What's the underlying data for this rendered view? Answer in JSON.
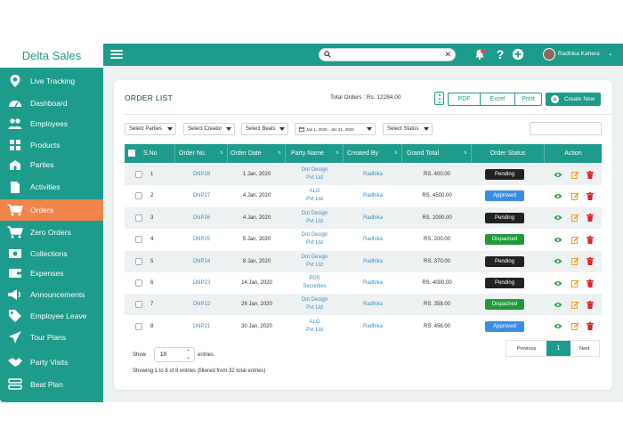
{
  "app": {
    "brand": "Delta Sales"
  },
  "sidebar": {
    "items": [
      {
        "label": "Live Tracking",
        "icon": "map-pin-icon"
      },
      {
        "label": "Dashboard",
        "icon": "speedometer-icon"
      },
      {
        "label": "Employees",
        "icon": "users-icon"
      },
      {
        "label": "Products",
        "icon": "grid-icon"
      },
      {
        "label": "Parties",
        "icon": "building-icon"
      },
      {
        "label": "Activities",
        "icon": "document-icon"
      },
      {
        "label": "Orders",
        "icon": "cart-icon",
        "active": true
      },
      {
        "label": "Zero Orders",
        "icon": "cart-icon"
      },
      {
        "label": "Collections",
        "icon": "cash-icon"
      },
      {
        "label": "Expenses",
        "icon": "wallet-icon"
      },
      {
        "label": "Announcements",
        "icon": "megaphone-icon"
      },
      {
        "label": "Employee Leave",
        "icon": "tag-icon"
      },
      {
        "label": "Tour Plans",
        "icon": "plane-icon"
      },
      {
        "label": "Party Visits",
        "icon": "handshake-icon"
      },
      {
        "label": "Beat Plan",
        "icon": "list-icon"
      }
    ]
  },
  "topbar": {
    "search_value": "",
    "user_name": "Radhika Kahera",
    "icons": [
      "notification-icon",
      "help-icon",
      "add-icon"
    ]
  },
  "page": {
    "title": "ORDER LIST",
    "total_orders": "Total Orders : Rs. 12284.00",
    "export_buttons": [
      "PDF",
      "Excel",
      "Print"
    ],
    "create_label": "Create New",
    "filters": [
      "Select Parties",
      "Select Creator",
      "Select Beats",
      "Jan 1, 2020 - Jan 31, 2020",
      "Select Status"
    ]
  },
  "table": {
    "headers": [
      "S.No",
      "Order No.",
      "Order Date",
      "Party Name",
      "Created By",
      "Grand Total",
      "Order Status",
      "Action"
    ],
    "rows": [
      {
        "sno": "1",
        "order_no": "DNP28",
        "date": "1 Jan, 2020",
        "party": [
          "Dot Design",
          "Pvt Ltd"
        ],
        "created_by": "Radhika",
        "total": "RS. 400.00",
        "status": "Pending"
      },
      {
        "sno": "2",
        "order_no": "DNP27",
        "date": "4 Jan, 2020",
        "party": [
          "ALG",
          "Pvt Ltd"
        ],
        "created_by": "Radhika",
        "total": "RS. 4500.00",
        "status": "Approved"
      },
      {
        "sno": "3",
        "order_no": "DNP26",
        "date": "4 Jan, 2020",
        "party": [
          "Dot Design",
          "Pvt Ltd"
        ],
        "created_by": "Radhika",
        "total": "RS. 2000.00",
        "status": "Pending"
      },
      {
        "sno": "4",
        "order_no": "DNP25",
        "date": "5 Jan, 2020",
        "party": [
          "Dot Design",
          "Pvt Ltd"
        ],
        "created_by": "Radhika",
        "total": "RS. 200.00",
        "status": "Dispached"
      },
      {
        "sno": "5",
        "order_no": "DNP24",
        "date": "8 Jan, 2020",
        "party": [
          "Dot Design",
          "Pvt Ltd"
        ],
        "created_by": "Radhika",
        "total": "RS. 370.00",
        "status": "Pending"
      },
      {
        "sno": "6",
        "order_no": "DNP23",
        "date": "14 Jan, 2020",
        "party": [
          "PDS",
          "Securities"
        ],
        "created_by": "Radhika",
        "total": "RS. 4000.00",
        "status": "Pending"
      },
      {
        "sno": "7",
        "order_no": "DNP22",
        "date": "26 Jan, 2020",
        "party": [
          "Dot Design",
          "Pvt Ltd"
        ],
        "created_by": "Radhika",
        "total": "RS. 358.00",
        "status": "Dispached"
      },
      {
        "sno": "8",
        "order_no": "DNP21",
        "date": "30 Jan, 2020",
        "party": [
          "ALG",
          "Pvt Ltd"
        ],
        "created_by": "Radhika",
        "total": "RS. 456.00",
        "status": "Approved"
      }
    ]
  },
  "footer": {
    "show_label": "Show",
    "entries_value": "10",
    "entries_label": "entries",
    "showing_text": "Showing 1 to 8 of 8 entries (filtered from 32 total entries)",
    "pager": {
      "previous": "Previous",
      "current": "1",
      "next": "Next"
    }
  },
  "colors": {
    "primary": "#1d9b8d",
    "active_nav": "#f2844a",
    "pending": "#222222",
    "approved": "#3b8de0",
    "dispached": "#1f9a3a"
  }
}
